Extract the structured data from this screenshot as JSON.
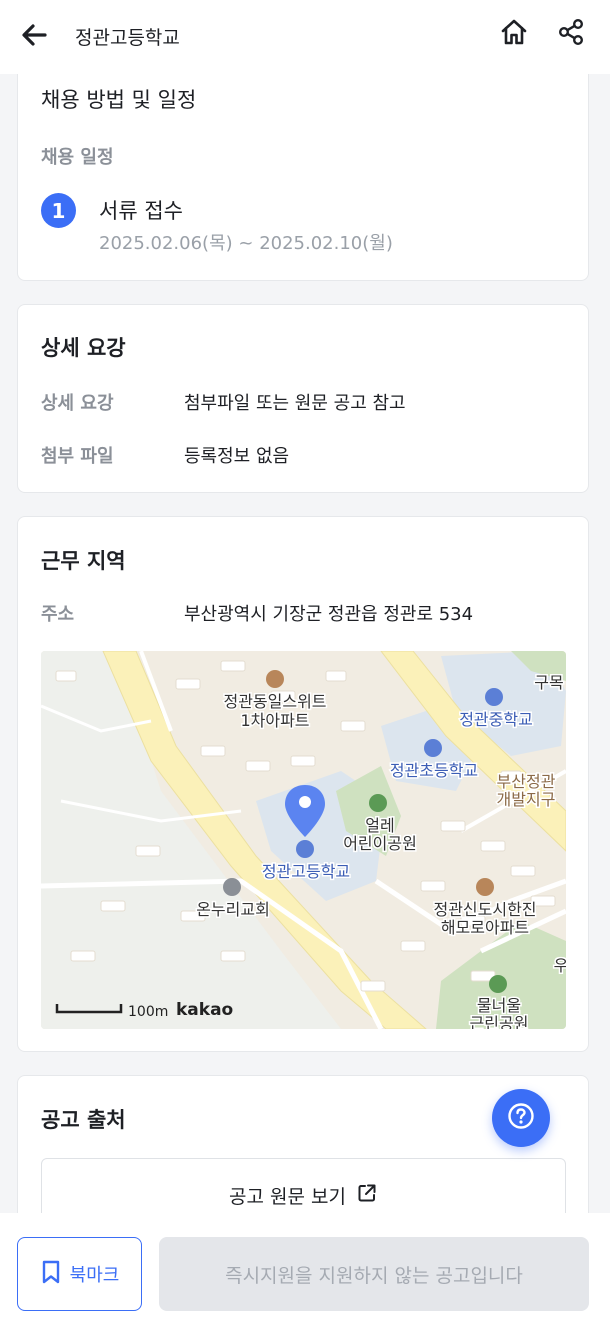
{
  "header": {
    "title": "정관고등학교",
    "back_icon": "arrow-left-icon",
    "home_icon": "home-icon",
    "share_icon": "share-icon"
  },
  "schedule": {
    "title": "채용 방법 및 일정",
    "section_label": "채용 일정",
    "steps": [
      {
        "number": "1",
        "title": "서류 접수",
        "date": "2025.02.06(목) ~ 2025.02.10(월)"
      }
    ]
  },
  "detail": {
    "title": "상세 요강",
    "rows": [
      {
        "label": "상세 요강",
        "value": "첨부파일 또는 원문 공고 참고"
      },
      {
        "label": "첨부 파일",
        "value": "등록정보 없음"
      }
    ]
  },
  "location": {
    "title": "근무 지역",
    "address_label": "주소",
    "address": "부산광역시 기장군 정관읍 정관로 534",
    "map": {
      "labels": {
        "apt1_line1": "정관동일스위트",
        "apt1_line2": "1차아파트",
        "middle_school": "정관중학교",
        "elementary_school": "정관초등학교",
        "target_school": "정관고등학교",
        "park1_line1": "얼레",
        "park1_line2": "어린이공원",
        "district_line1": "부산정관",
        "district_line2": "개발지구",
        "church": "온누리교회",
        "apt2_line1": "정관신도시한진",
        "apt2_line2": "해모로아파트",
        "park2_line1": "물너울",
        "park2_line2": "근린공원",
        "edge_top_right": "구목",
        "edge_right": "우"
      },
      "scale_text": "100m",
      "brand": "kakao"
    }
  },
  "source": {
    "title": "공고 출처",
    "view_original": "공고 원문 보기",
    "external_icon": "external-link-icon"
  },
  "help_icon": "question-icon",
  "bottom": {
    "bookmark_label": "북마크",
    "bookmark_icon": "bookmark-icon",
    "apply_label": "즉시지원을 지원하지 않는 공고입니다"
  },
  "colors": {
    "accent": "#3b6ef6",
    "label_gray": "#8b9098",
    "disabled_bg": "#e4e6ea",
    "disabled_text": "#a5aab2"
  }
}
